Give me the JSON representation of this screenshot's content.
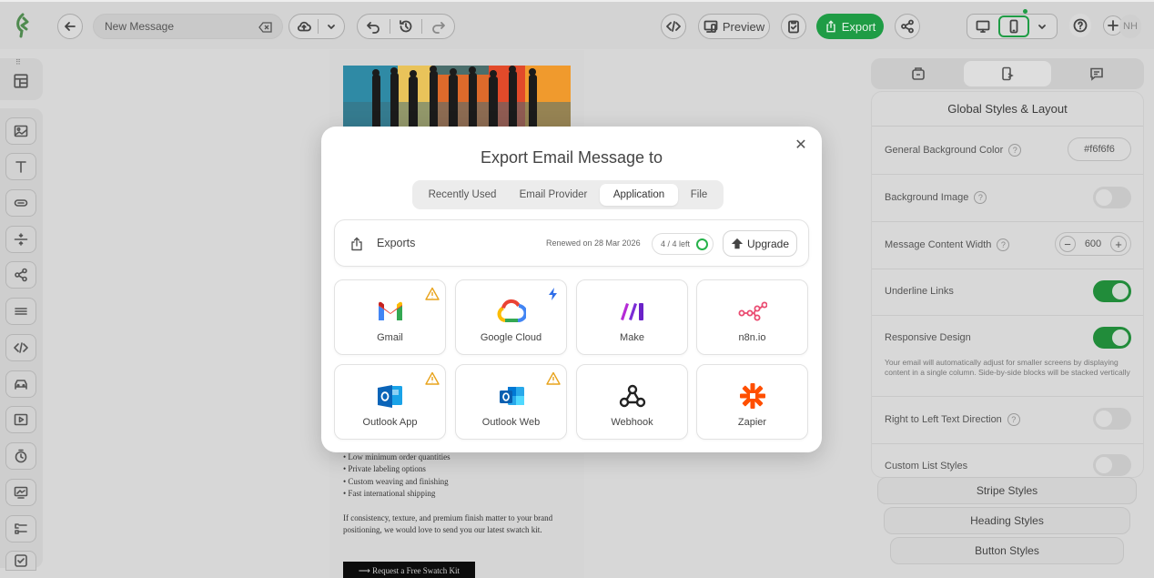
{
  "topbar": {
    "message_title": "New Message",
    "preview_label": "Preview",
    "export_label": "Export",
    "avatar_initials": "NH",
    "brand_color": "#1f9c45"
  },
  "email": {
    "bullets": [
      "• Low minimum order quantities",
      "• Private labeling options",
      "• Custom weaving and finishing",
      "• Fast international shipping"
    ],
    "paragraph": "If consistency, texture, and premium finish matter to your brand positioning, we would love to send you our latest swatch kit.",
    "cta": "⟶ Request a Free Swatch Kit"
  },
  "panel": {
    "title": "Global Styles & Layout",
    "bg_color_label": "General Background Color",
    "bg_color_value": "#f6f6f6",
    "bg_image_label": "Background Image",
    "width_label": "Message Content Width",
    "width_value": "600",
    "underline_label": "Underline Links",
    "responsive_label": "Responsive Design",
    "responsive_desc": "Your email will automatically adjust for smaller screens by displaying content in a single column. Side-by-side blocks will be stacked vertically",
    "rtl_label": "Right to Left Text Direction",
    "list_label": "Custom List Styles",
    "toggles": {
      "bg_image": false,
      "underline": true,
      "responsive": true,
      "rtl": false,
      "list": false
    },
    "sections": [
      "Stripe Styles",
      "Heading Styles",
      "Button Styles"
    ]
  },
  "modal": {
    "title": "Export Email Message to",
    "tabs": [
      "Recently Used",
      "Email Provider",
      "Application",
      "File"
    ],
    "active_tab": "Application",
    "exports_label": "Exports",
    "renewed": "Renewed on 28 Mar 2026",
    "quota": "4 / 4 left",
    "upgrade": "Upgrade",
    "apps": [
      {
        "name": "Gmail",
        "icon": "gmail-icon",
        "badge": "warning-icon"
      },
      {
        "name": "Google Cloud",
        "icon": "google-cloud-icon",
        "badge": "bolt-icon"
      },
      {
        "name": "Make",
        "icon": "make-icon",
        "badge": ""
      },
      {
        "name": "n8n.io",
        "icon": "n8n-icon",
        "badge": ""
      },
      {
        "name": "Outlook App",
        "icon": "outlook-icon",
        "badge": "warning-icon"
      },
      {
        "name": "Outlook Web",
        "icon": "outlook-web-icon",
        "badge": "warning-icon"
      },
      {
        "name": "Webhook",
        "icon": "webhook-icon",
        "badge": ""
      },
      {
        "name": "Zapier",
        "icon": "zapier-icon",
        "badge": ""
      }
    ]
  }
}
